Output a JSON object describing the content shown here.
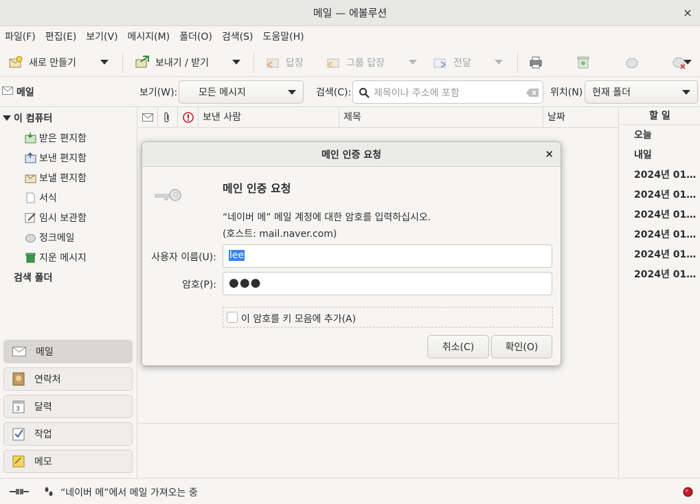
{
  "window": {
    "title": "메일 — 에볼루션",
    "close": "×"
  },
  "menu": [
    "파일(F)",
    "편집(E)",
    "보기(V)",
    "메시지(M)",
    "폴더(O)",
    "검색(S)",
    "도움말(H)"
  ],
  "toolbar": {
    "new": "새로 만들기",
    "send_receive": "보내기 / 받기",
    "reply": "답장",
    "reply_group": "그룹 답장",
    "forward": "전달"
  },
  "searchbar": {
    "section": "메일",
    "view_label": "보기(W):",
    "view_value": "모든 메시지",
    "search_label": "검색(C):",
    "search_placeholder": "제목이나 주소에 포함",
    "location_label": "위치(N)",
    "location_value": "현재 폴더"
  },
  "folders": {
    "root": "이 컴퓨터",
    "items": [
      "받은 편지함",
      "보낸 편지함",
      "보낼 편지함",
      "서식",
      "임시 보관함",
      "정크메일",
      "지운 메시지"
    ],
    "search_folders": "검색 폴더"
  },
  "switcher": [
    "메일",
    "연락처",
    "달력",
    "작업",
    "메모"
  ],
  "list_columns": {
    "sender": "보낸 사람",
    "subject": "제목",
    "date": "날짜"
  },
  "todo": {
    "title": "할 일",
    "items": [
      "오늘",
      "내일",
      "2024년 01…",
      "2024년 01…",
      "2024년 01…",
      "2024년 01…",
      "2024년 01…",
      "2024년 01…"
    ]
  },
  "status": {
    "message": "“네이버 메”에서 메일 가져오는 중"
  },
  "dialog": {
    "title": "메인 인증 요청",
    "heading": "메인 인증 요청",
    "message": "“네이버 메” 메일 계정에 대한 암호를 입력하십시오.",
    "host": "(호스트: mail.naver.com)",
    "username_label": "사용자 이름(U):",
    "username_value": "lee",
    "password_label": "암호(P):",
    "password_mask": "●●●",
    "keyring_label": "이 암호를 키 모음에 추가(A)",
    "keyring_checked": false,
    "cancel": "취소(C)",
    "ok": "확인(O)",
    "close": "×"
  },
  "colors": {
    "accent": "#3584e4",
    "stop": "#c01c28"
  }
}
